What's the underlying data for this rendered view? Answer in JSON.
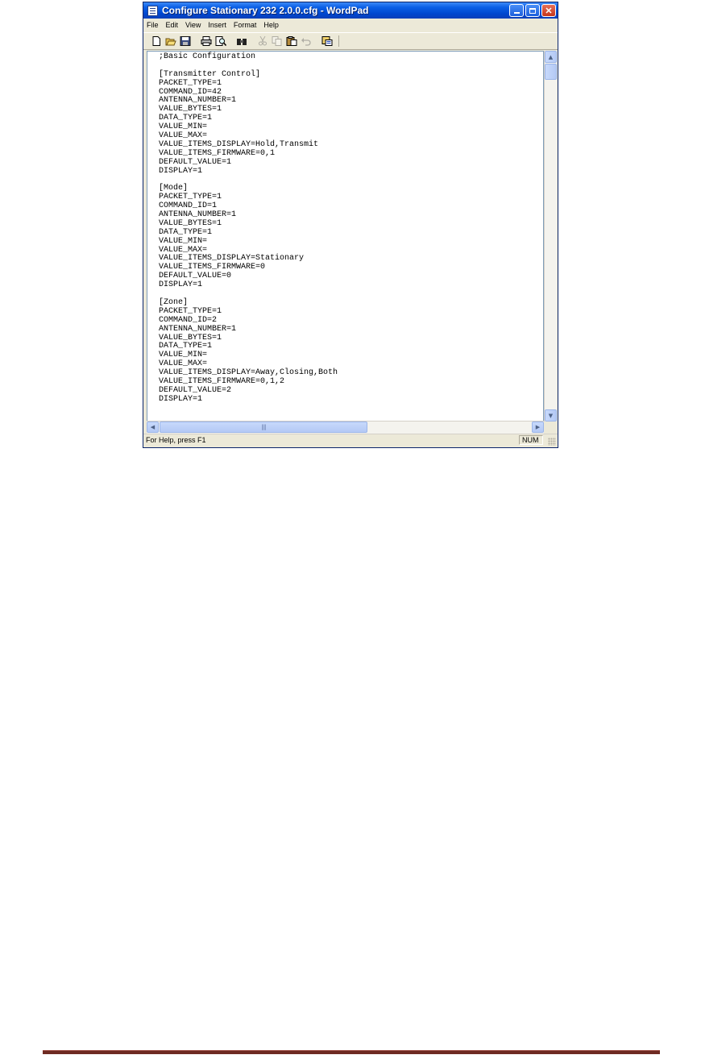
{
  "window": {
    "title": "Configure Stationary 232 2.0.0.cfg - WordPad"
  },
  "menu": {
    "items": [
      "File",
      "Edit",
      "View",
      "Insert",
      "Format",
      "Help"
    ]
  },
  "toolbar": {
    "icons": [
      "new-icon",
      "open-icon",
      "save-icon",
      "print-icon",
      "print-preview-icon",
      "find-icon",
      "cut-icon",
      "copy-icon",
      "paste-icon",
      "undo-icon",
      "date-time-icon"
    ]
  },
  "document": {
    "lines": [
      ";Basic Configuration",
      "",
      "[Transmitter Control]",
      "PACKET_TYPE=1",
      "COMMAND_ID=42",
      "ANTENNA_NUMBER=1",
      "VALUE_BYTES=1",
      "DATA_TYPE=1",
      "VALUE_MIN=",
      "VALUE_MAX=",
      "VALUE_ITEMS_DISPLAY=Hold,Transmit",
      "VALUE_ITEMS_FIRMWARE=0,1",
      "DEFAULT_VALUE=1",
      "DISPLAY=1",
      "",
      "[Mode]",
      "PACKET_TYPE=1",
      "COMMAND_ID=1",
      "ANTENNA_NUMBER=1",
      "VALUE_BYTES=1",
      "DATA_TYPE=1",
      "VALUE_MIN=",
      "VALUE_MAX=",
      "VALUE_ITEMS_DISPLAY=Stationary",
      "VALUE_ITEMS_FIRMWARE=0",
      "DEFAULT_VALUE=0",
      "DISPLAY=1",
      "",
      "[Zone]",
      "PACKET_TYPE=1",
      "COMMAND_ID=2",
      "ANTENNA_NUMBER=1",
      "VALUE_BYTES=1",
      "DATA_TYPE=1",
      "VALUE_MIN=",
      "VALUE_MAX=",
      "VALUE_ITEMS_DISPLAY=Away,Closing,Both",
      "VALUE_ITEMS_FIRMWARE=0,1,2",
      "DEFAULT_VALUE=2",
      "DISPLAY=1"
    ]
  },
  "status": {
    "help_text": "For Help, press F1",
    "num_indicator": "NUM"
  },
  "colors": {
    "titlebar": "#0b5fe6",
    "window_face": "#ece9d8",
    "footer_rule": "#6e2a22"
  }
}
